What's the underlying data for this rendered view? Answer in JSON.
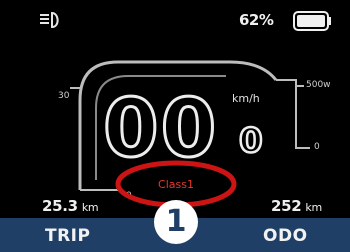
{
  "status_bar": {
    "battery_percent": "62%",
    "battery_level": 0.62,
    "headlight_icon": "headlight-icon",
    "battery_icon": "battery-icon"
  },
  "speedometer": {
    "speed_integer": "00",
    "speed_decimal": "0",
    "unit": "km/h",
    "scale_max_label": "30",
    "scale_min_label": "0"
  },
  "power_meter": {
    "max_label": "500w",
    "min_label": "0"
  },
  "class_label": "Class1",
  "trip": {
    "value": "25.3",
    "unit": "km",
    "label": "TRIP"
  },
  "odo": {
    "value": "252",
    "unit": "km",
    "label": "ODO"
  },
  "assist_level": "1",
  "colors": {
    "background": "#000000",
    "frame": "#bdbdbd",
    "class_text": "#e8342c",
    "highlight_ring": "#cc1414",
    "bottom_bar": "#1f3f66",
    "text": "#f0f0f0"
  }
}
